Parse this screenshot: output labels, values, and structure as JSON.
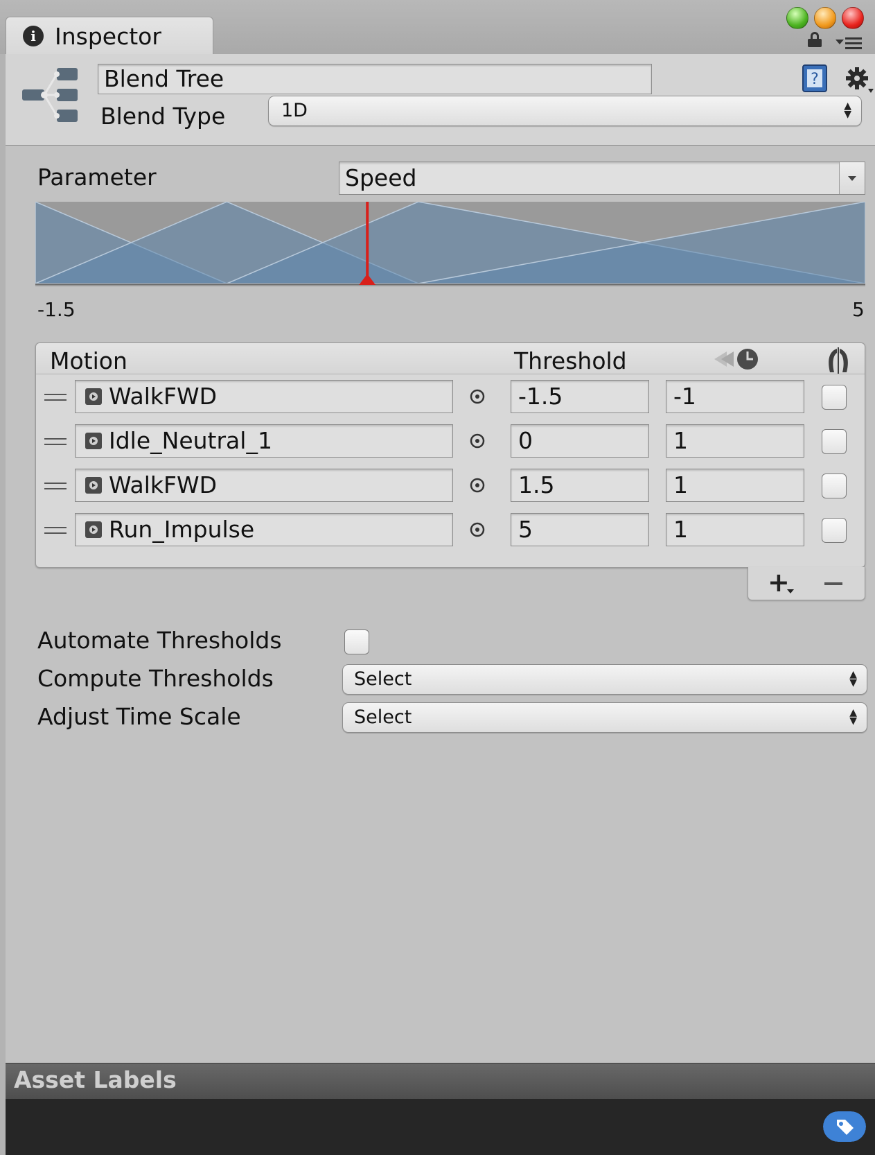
{
  "window": {
    "tab_title": "Inspector"
  },
  "header": {
    "name_value": "Blend Tree",
    "blend_type_label": "Blend Type",
    "blend_type_value": "1D"
  },
  "parameter": {
    "label": "Parameter",
    "value": "Speed"
  },
  "blend_graph": {
    "range_min_label": "-1.5",
    "range_max_label": "5",
    "range_min": -1.5,
    "range_max": 5,
    "thresholds": [
      -1.5,
      0,
      1.5,
      5
    ],
    "marker_value": 1.1,
    "fill_color": "#5f86ad",
    "marker_color": "#d8201b"
  },
  "motion_list": {
    "col_motion": "Motion",
    "col_threshold": "Threshold",
    "rows": [
      {
        "motion": "WalkFWD",
        "threshold": "-1.5",
        "time_scale": "-1"
      },
      {
        "motion": "Idle_Neutral_1",
        "threshold": "0",
        "time_scale": "1"
      },
      {
        "motion": "WalkFWD",
        "threshold": "1.5",
        "time_scale": "1"
      },
      {
        "motion": "Run_Impulse",
        "threshold": "5",
        "time_scale": "1"
      }
    ]
  },
  "options": {
    "automate_label": "Automate Thresholds",
    "compute_label": "Compute Thresholds",
    "compute_value": "Select",
    "adjust_label": "Adjust Time Scale",
    "adjust_value": "Select"
  },
  "asset_labels": {
    "title": "Asset Labels"
  },
  "colors": {
    "panel_bg": "#c2c2c2",
    "tag_button": "#3e82d6"
  }
}
